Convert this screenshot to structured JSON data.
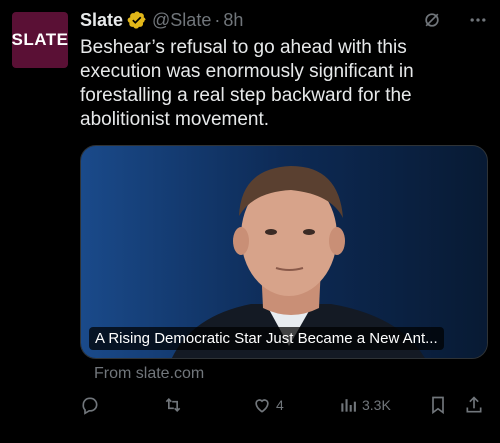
{
  "avatar": {
    "text": "SLATE"
  },
  "tweet": {
    "name": "Slate",
    "handle": "@Slate",
    "time": "8h",
    "separator": "·",
    "text": "Beshear’s refusal to go ahead with this execution was enormously significant in forestalling a real step backward for the abolitionist movement."
  },
  "card": {
    "headline": "A Rising Democratic Star Just Became a New Ant...",
    "source": "From slate.com"
  },
  "actions": {
    "reply_count": "",
    "retweet_count": "",
    "like_count": "4",
    "views_count": "3.3K"
  },
  "icons": {
    "verified": "verified-badge-icon",
    "grok": "grok-icon",
    "more": "more-icon",
    "reply": "reply-icon",
    "retweet": "retweet-icon",
    "like": "like-icon",
    "views": "views-icon",
    "bookmark": "bookmark-icon",
    "share": "share-icon"
  },
  "colors": {
    "accent": "#e2b719",
    "avatar_bg": "#5a1035",
    "muted": "#71767b"
  }
}
